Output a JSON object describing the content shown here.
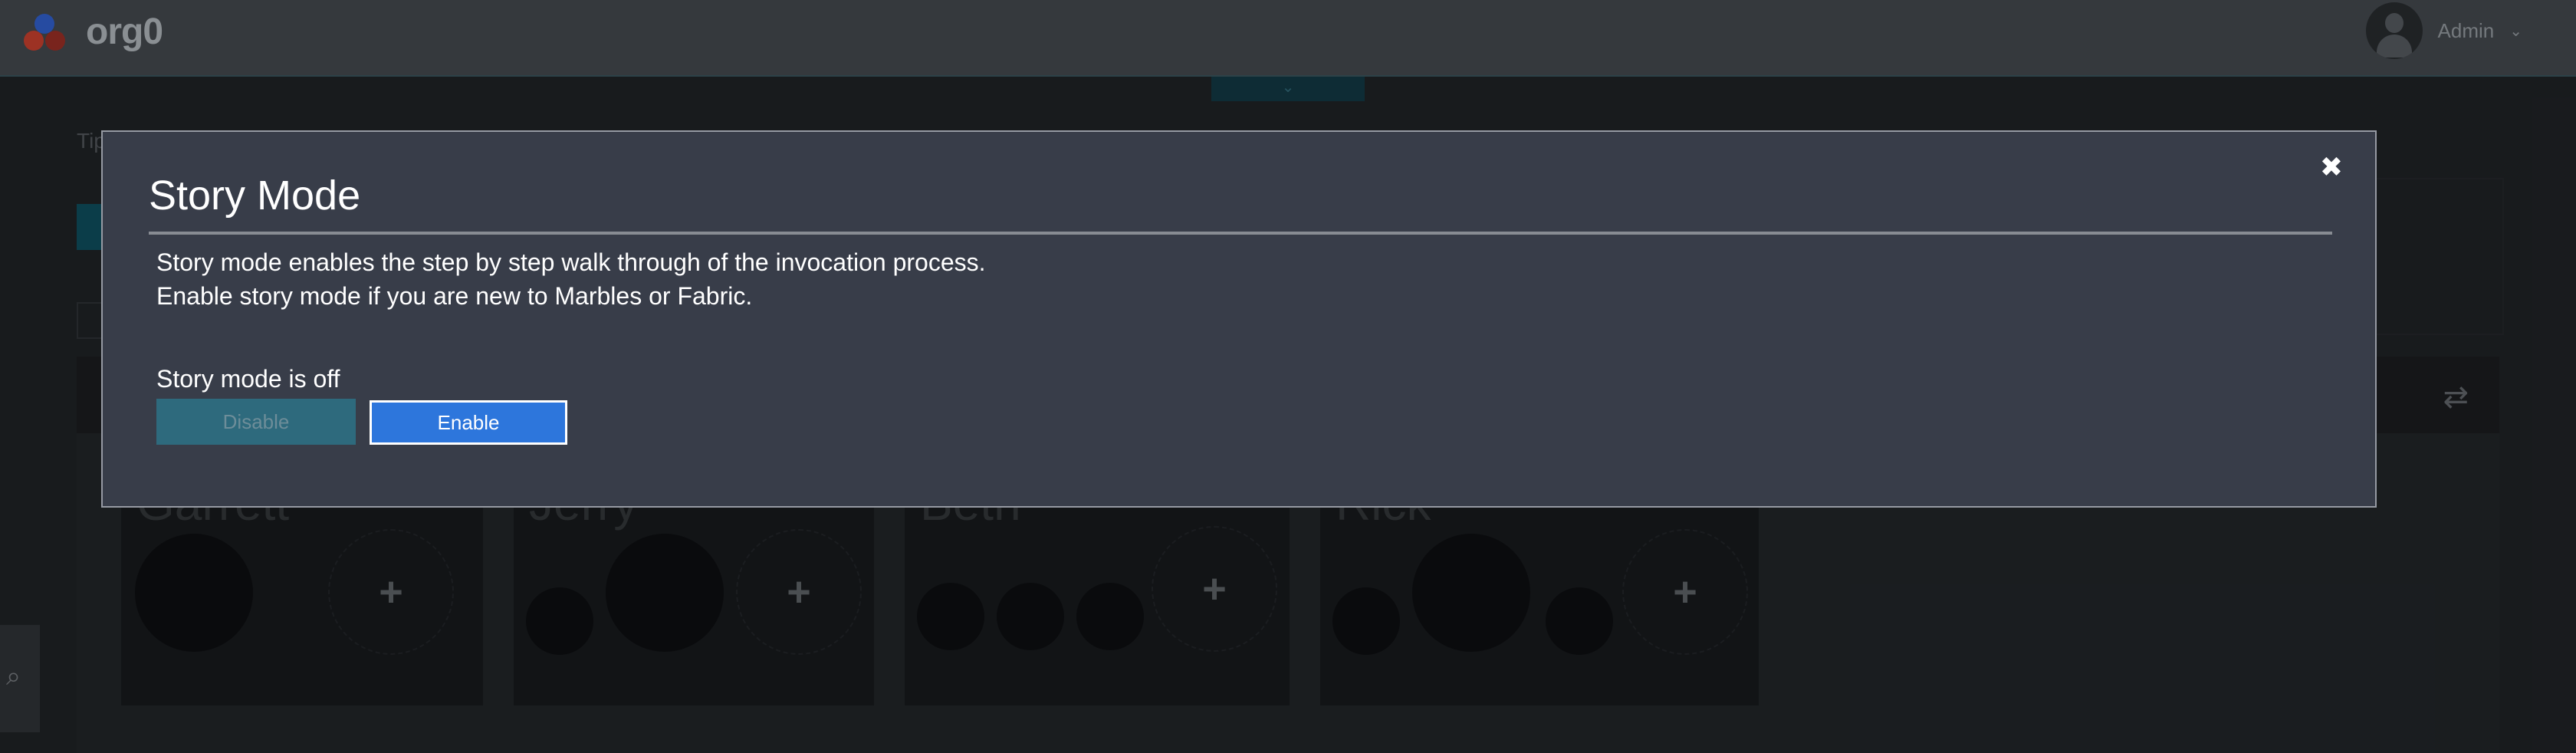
{
  "header": {
    "brand": "org0",
    "user_label": "Admin",
    "user_chevron": "⌄",
    "logo_icon": "marbles-logo-icon"
  },
  "background": {
    "tip_text": "Tip",
    "pulltab_icon": "chevron-down-icon",
    "swap_icon": "⇄",
    "search_icon": "⌕",
    "users": [
      {
        "name": "Garrett",
        "add_label": "+"
      },
      {
        "name": "Jerry",
        "add_label": "+"
      },
      {
        "name": "Beth",
        "add_label": "+"
      },
      {
        "name": "Rick",
        "add_label": "+"
      }
    ]
  },
  "modal": {
    "title": "Story Mode",
    "close_icon": "✖",
    "description_line1": "Story mode enables the step by step walk through of the invocation process.",
    "description_line2": "Enable story mode if you are new to Marbles or Fabric.",
    "status_text": "Story mode is off",
    "disable_label": "Disable",
    "enable_label": "Enable"
  },
  "colors": {
    "modal_bg": "#383d49",
    "enable_bg": "#2d76dc",
    "disable_bg": "#2e6a7d",
    "topbar_bg": "#3d4146"
  }
}
